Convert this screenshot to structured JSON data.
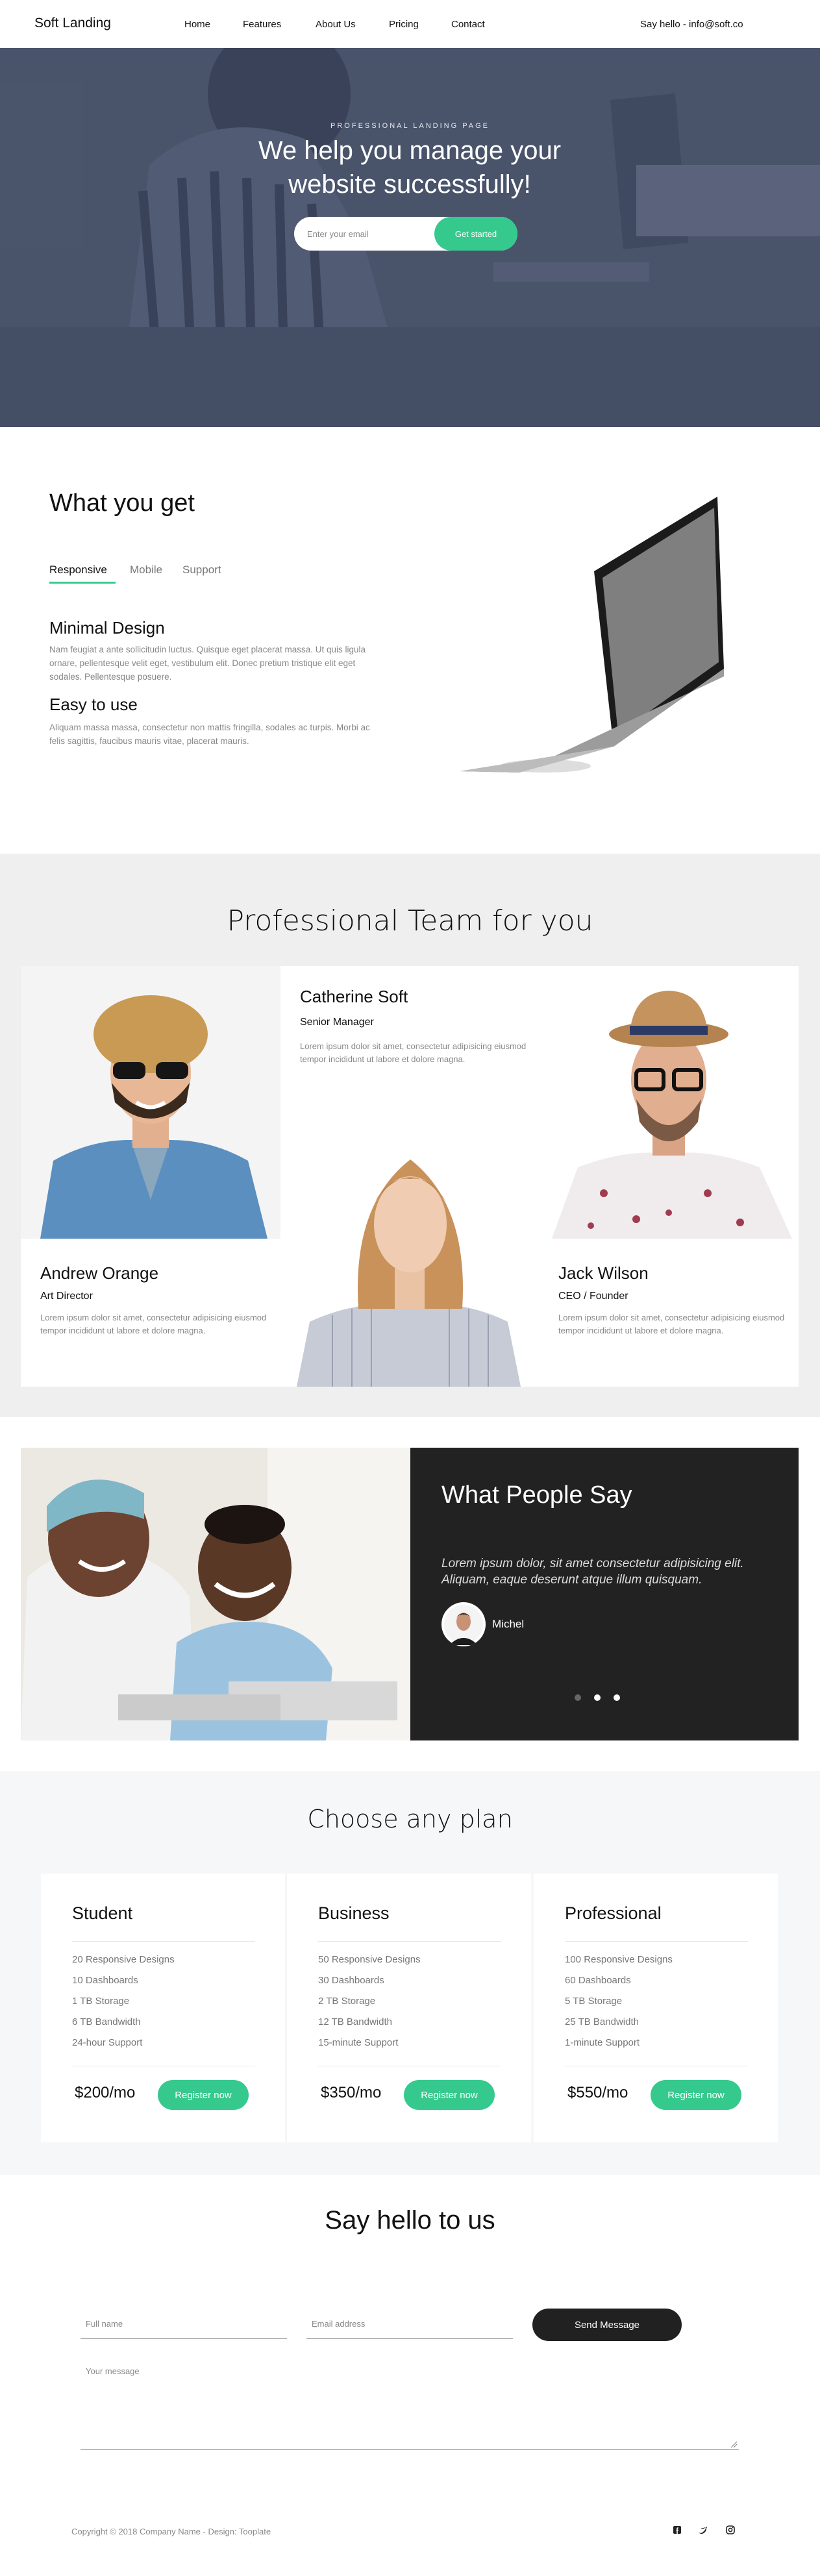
{
  "nav": {
    "brand": "Soft Landing",
    "links": [
      "Home",
      "Features",
      "About Us",
      "Pricing",
      "Contact"
    ],
    "contact": "Say hello - info@soft.co"
  },
  "hero": {
    "kicker": "PROFESSIONAL LANDING PAGE",
    "title": "We help you manage your website successfully!",
    "email_placeholder": "Enter your email",
    "button": "Get started"
  },
  "features": {
    "title": "What you get",
    "tabs": [
      "Responsive",
      "Mobile",
      "Support"
    ],
    "active_tab": "Responsive",
    "items": [
      {
        "heading": "Minimal Design",
        "text": "Nam feugiat a ante sollicitudin luctus. Quisque eget placerat massa. Ut quis ligula ornare, pellentesque velit eget, vestibulum elit. Donec pretium tristique elit eget sodales. Pellentesque posuere."
      },
      {
        "heading": "Easy to use",
        "text": "Aliquam massa massa, consectetur non mattis fringilla, sodales ac turpis. Morbi ac felis sagittis, faucibus mauris vitae, placerat mauris."
      }
    ]
  },
  "team": {
    "title": "Professional Team for you",
    "members": [
      {
        "name": "Andrew Orange",
        "role": "Art Director",
        "text": "Lorem ipsum dolor sit amet, consectetur adipisicing eiusmod tempor incididunt ut labore et dolore magna."
      },
      {
        "name": "Catherine Soft",
        "role": "Senior Manager",
        "text": "Lorem ipsum dolor sit amet, consectetur adipisicing eiusmod tempor incididunt ut labore et dolore magna."
      },
      {
        "name": "Jack Wilson",
        "role": "CEO / Founder",
        "text": "Lorem ipsum dolor sit amet, consectetur adipisicing eiusmod tempor incididunt ut labore et dolore magna."
      }
    ]
  },
  "testimonial": {
    "title": "What People Say",
    "quote": "Lorem ipsum dolor, sit amet consectetur adipisicing elit. Aliquam, eaque deserunt atque illum quisquam.",
    "author": "Michel",
    "slides": 3,
    "active_slide": 2
  },
  "pricing": {
    "title": "Choose any plan",
    "plans": [
      {
        "name": "Student",
        "features": [
          "20 Responsive Designs",
          "10 Dashboards",
          "1 TB Storage",
          "6 TB Bandwidth",
          "24-hour Support"
        ],
        "price": "$200/mo",
        "button": "Register now"
      },
      {
        "name": "Business",
        "features": [
          "50 Responsive Designs",
          "30 Dashboards",
          "2 TB Storage",
          "12 TB Bandwidth",
          "15-minute Support"
        ],
        "price": "$350/mo",
        "button": "Register now"
      },
      {
        "name": "Professional",
        "features": [
          "100 Responsive Designs",
          "60 Dashboards",
          "5 TB Storage",
          "25 TB Bandwidth",
          "1-minute Support"
        ],
        "price": "$550/mo",
        "button": "Register now"
      }
    ]
  },
  "contact": {
    "title": "Say hello to us",
    "name_placeholder": "Full name",
    "email_placeholder": "Email address",
    "message_placeholder": "Your message",
    "button": "Send Message"
  },
  "footer": {
    "copyright": "Copyright © 2018 Company Name - Design: Tooplate",
    "social": [
      "facebook-icon",
      "twitter-icon",
      "instagram-icon"
    ]
  },
  "colors": {
    "accent": "#36c98e",
    "dark": "#222222"
  }
}
